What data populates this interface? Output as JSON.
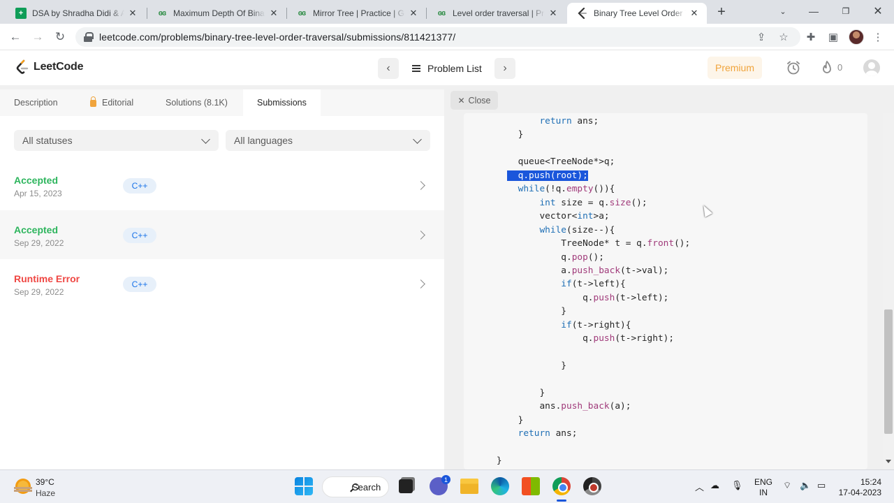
{
  "browser": {
    "tabs": [
      {
        "title": "DSA by Shradha Didi & Aman Bhaiya",
        "favicon": "sheets-icon"
      },
      {
        "title": "Maximum Depth Of Binary Tree",
        "favicon": "gfg-icon"
      },
      {
        "title": "Mirror Tree | Practice | GeeksforGeeks",
        "favicon": "gfg-icon"
      },
      {
        "title": "Level order traversal | Practice",
        "favicon": "gfg-icon"
      },
      {
        "title": "Binary Tree Level Order Traversal",
        "favicon": "leetcode-icon"
      }
    ],
    "active_tab_index": 4,
    "url": "leetcode.com/problems/binary-tree-level-order-traversal/submissions/811421377/"
  },
  "header": {
    "logo_text": "LeetCode",
    "problem_list_label": "Problem List",
    "premium_label": "Premium",
    "streak_count": "0"
  },
  "left_panel": {
    "tabs": [
      "Description",
      "Editorial",
      "Solutions (8.1K)",
      "Submissions"
    ],
    "active_tab": "Submissions",
    "filters": {
      "status": "All statuses",
      "language": "All languages"
    },
    "submissions": [
      {
        "status": "Accepted",
        "date": "Apr 15, 2023",
        "lang": "C++"
      },
      {
        "status": "Accepted",
        "date": "Sep 29, 2022",
        "lang": "C++"
      },
      {
        "status": "Runtime Error",
        "date": "Sep 29, 2022",
        "lang": "C++"
      }
    ]
  },
  "right_panel": {
    "close_label": "Close",
    "code_lines": [
      "            return ans;",
      "        }",
      "",
      "        queue<TreeNode*>q;",
      "        q.push(root);",
      "        while(!q.empty()){",
      "            int size = q.size();",
      "            vector<int>a;",
      "            while(size--){",
      "                TreeNode* t = q.front();",
      "                q.pop();",
      "                a.push_back(t->val);",
      "                if(t->left){",
      "                    q.push(t->left);",
      "                }",
      "                if(t->right){",
      "                    q.push(t->right);",
      "",
      "                }",
      "",
      "            }",
      "            ans.push_back(a);",
      "        }",
      "        return ans;",
      "",
      "    }"
    ],
    "highlighted_line_index": 4
  },
  "taskbar": {
    "temperature": "39°C",
    "condition": "Haze",
    "search_label": "Search",
    "chat_badge": "1",
    "language_line1": "ENG",
    "language_line2": "IN",
    "time": "15:24",
    "date": "17-04-2023"
  },
  "colors": {
    "accepted": "#2db55d",
    "error": "#ef4743",
    "premium": "#f0a43c",
    "keyword": "#1f6fb5",
    "function": "#a03a7a",
    "selection": "#1a56db"
  }
}
